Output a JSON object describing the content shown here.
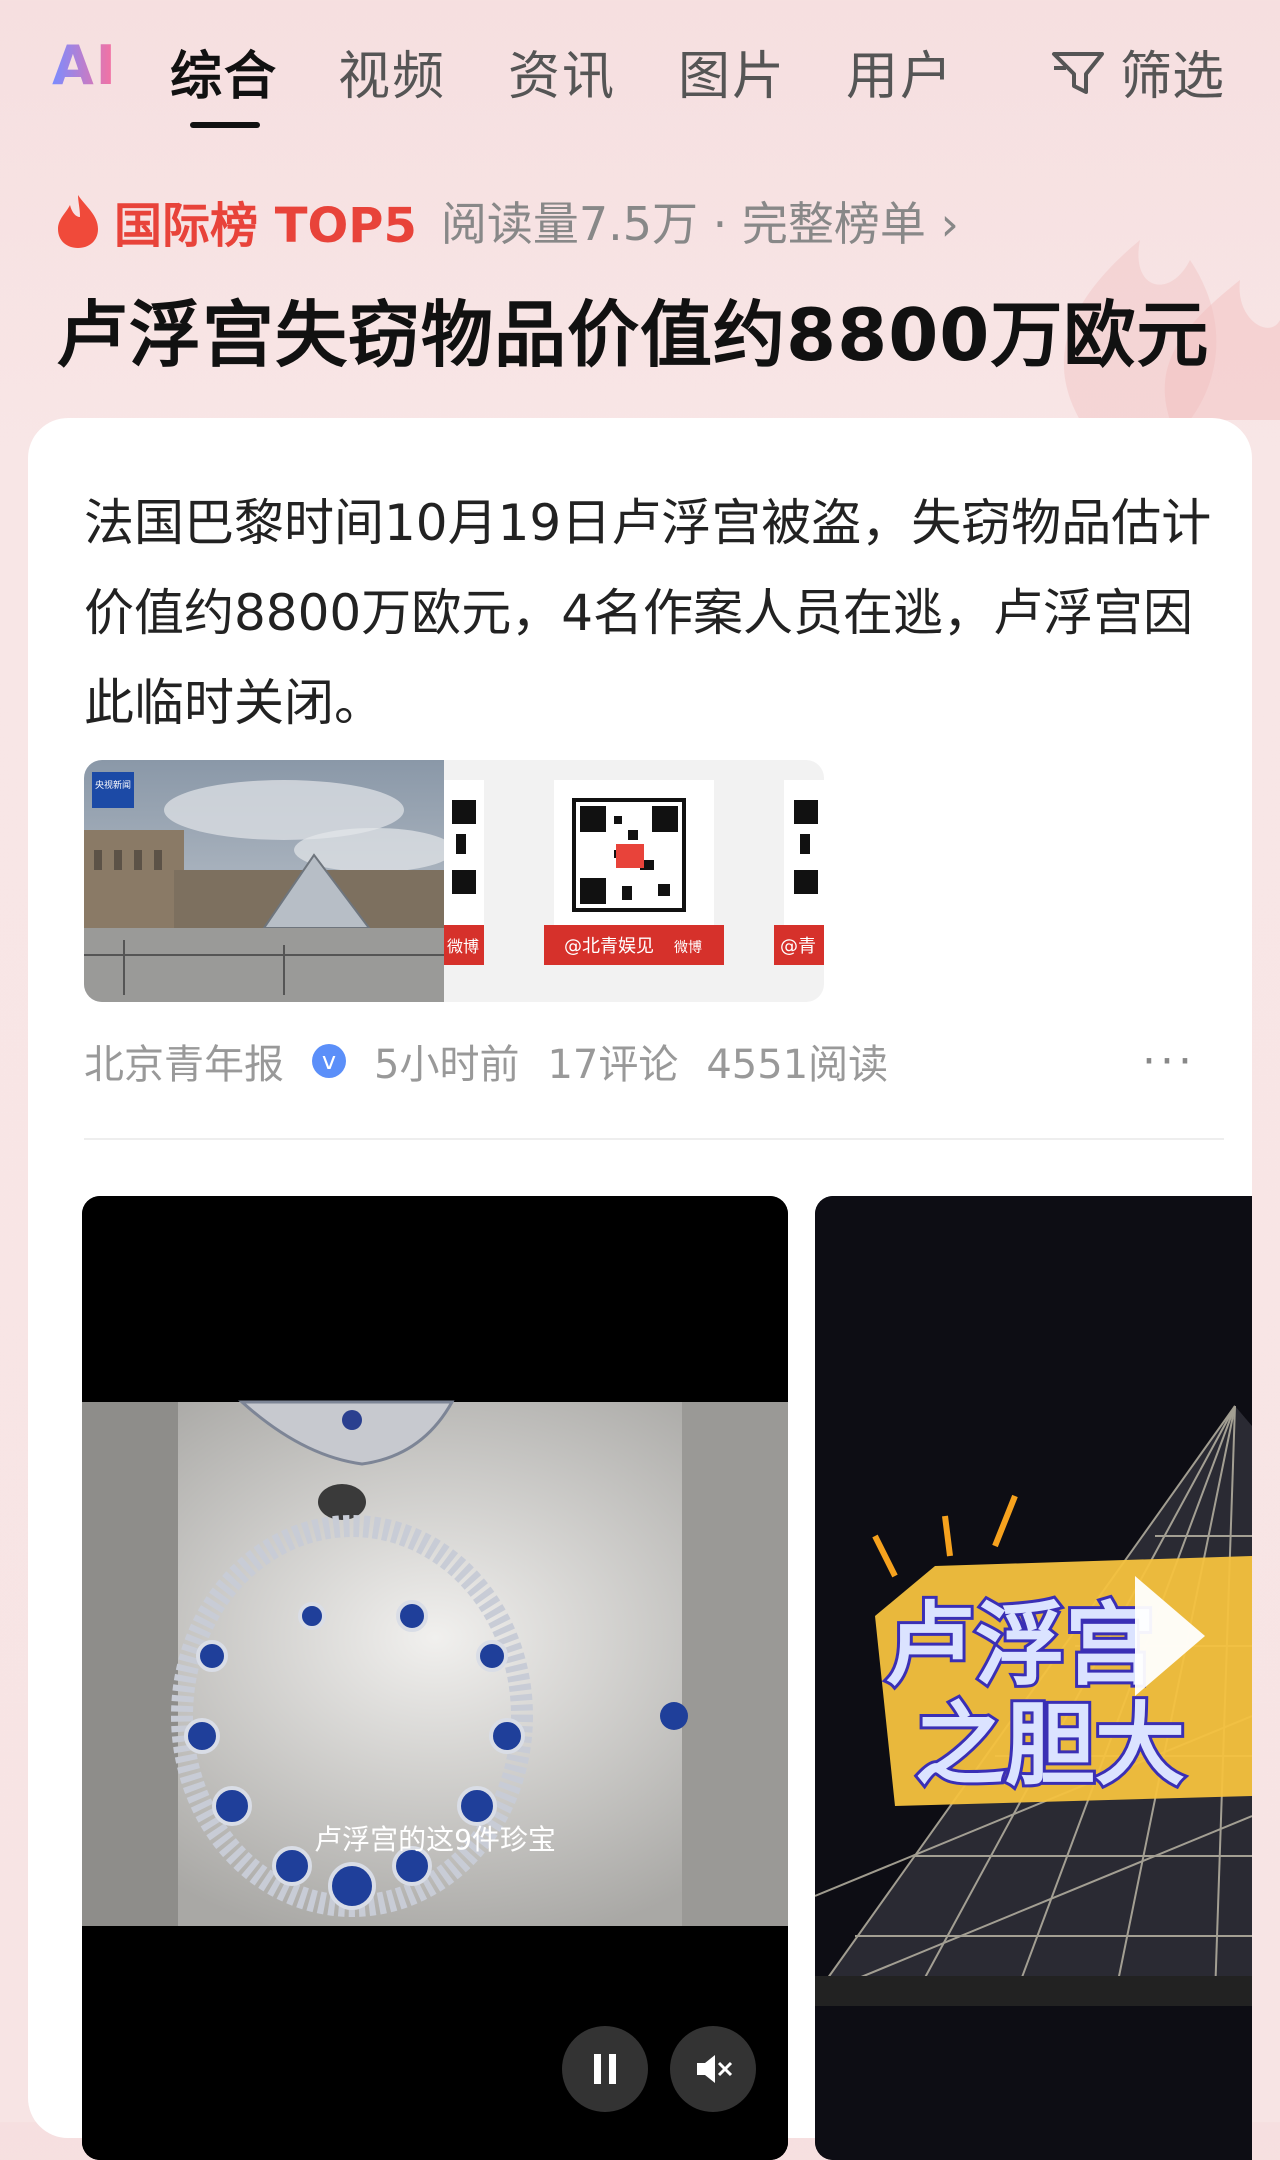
{
  "tabs": {
    "ai": "AI",
    "items": [
      "综合",
      "视频",
      "资讯",
      "图片",
      "用户"
    ],
    "active": "综合",
    "filter_label": "筛选"
  },
  "rank": {
    "title": "国际榜 TOP5",
    "meta": "阅读量7.5万 · 完整榜单 ›"
  },
  "headline": "卢浮宫失窃物品价值约8800万欧元",
  "article": {
    "summary": "法国巴黎时间10月19日卢浮宫被盗，失窃物品估计价值约8800万欧元，4名作案人员在逃，卢浮宫因此临时关闭。",
    "image_badge": "央视新闻",
    "qr_label_center": "@北青娱见",
    "qr_label_weibo": "微博",
    "qr_label_left": "微博",
    "qr_label_right": "@青",
    "source": "北京青年报",
    "verified": "v",
    "time": "5小时前",
    "comments": "17评论",
    "reads": "4551阅读",
    "more": "···"
  },
  "videos": {
    "video1_caption": "卢浮宫的这9件珍宝",
    "video2_title_line1": "卢浮宫",
    "video2_title_line2": "之胆大"
  },
  "colors": {
    "accent_red": "#e8433a",
    "verified_blue": "#5b8ff9"
  }
}
